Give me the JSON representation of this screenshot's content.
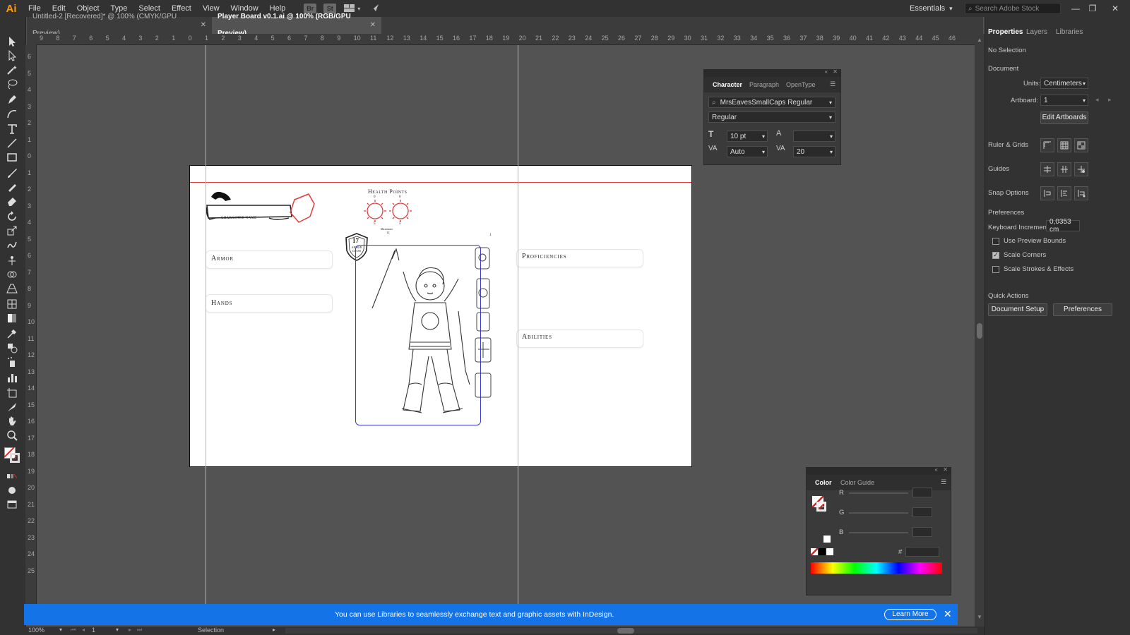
{
  "app": {
    "logo": "Ai",
    "menu": [
      "File",
      "Edit",
      "Object",
      "Type",
      "Select",
      "Effect",
      "View",
      "Window",
      "Help"
    ],
    "menubar_icons": [
      "Br",
      "St"
    ],
    "workspace": "Essentials",
    "search_placeholder": "Search Adobe Stock"
  },
  "tabs": [
    {
      "label": "Untitled-2 [Recovered]* @ 100% (CMYK/GPU Preview)"
    },
    {
      "label": "Player Board v0.1.ai @ 100% (RGB/GPU Preview)"
    }
  ],
  "hruler": [
    "9",
    "8",
    "7",
    "6",
    "5",
    "4",
    "3",
    "2",
    "1",
    "0",
    "1",
    "2",
    "3",
    "4",
    "5",
    "6",
    "7",
    "8",
    "9",
    "10",
    "11",
    "12",
    "13",
    "14",
    "15",
    "16",
    "17",
    "18",
    "19",
    "20",
    "21",
    "22",
    "23",
    "24",
    "25",
    "26",
    "27",
    "28",
    "29",
    "30",
    "31",
    "32",
    "33",
    "34",
    "35",
    "36",
    "37",
    "38",
    "39",
    "40",
    "41",
    "42",
    "43",
    "44",
    "45",
    "46"
  ],
  "vruler": [
    "6",
    "5",
    "4",
    "3",
    "2",
    "1",
    "0",
    "1",
    "2",
    "3",
    "4",
    "5",
    "6",
    "7",
    "8",
    "9",
    "10",
    "11",
    "12",
    "13",
    "14",
    "15",
    "16",
    "17",
    "18",
    "19",
    "20",
    "21",
    "22",
    "23",
    "24",
    "25"
  ],
  "artboard": {
    "character_name": "CHARACTER NAME",
    "health_points_title": "Health Points",
    "hp_values": [
      "0",
      "0"
    ],
    "hp_subvalues": [
      "5",
      "5"
    ],
    "hp_maximum_label": "Maximum",
    "hp_maximum_value": "12",
    "armor_class_value": "17",
    "armor_class_label": "ARMOR CLASS",
    "slot_number": "1",
    "armor_label": "Armor",
    "hands_label": "Hands",
    "proficiencies_label": "Proficiencies",
    "abilities_label": "Abilities"
  },
  "character_panel": {
    "tabs": [
      "Character",
      "Paragraph",
      "OpenType"
    ],
    "font_family": "MrsEavesSmallCaps Regular",
    "font_style": "Regular",
    "font_size": "10 pt",
    "leading": "",
    "kerning": "Auto",
    "tracking": "20"
  },
  "properties": {
    "tabs": [
      "Properties",
      "Layers",
      "Libraries"
    ],
    "selection": "No Selection",
    "document_heading": "Document",
    "units_label": "Units:",
    "units_value": "Centimeters",
    "artboard_label": "Artboard:",
    "artboard_value": "1",
    "edit_artboards": "Edit Artboards",
    "ruler_grids": "Ruler & Grids",
    "guides": "Guides",
    "snap_options": "Snap Options",
    "preferences_heading": "Preferences",
    "keyboard_increment_label": "Keyboard Increment:",
    "keyboard_increment_value": "0,0353 cm",
    "use_preview_bounds": "Use Preview Bounds",
    "scale_corners": "Scale Corners",
    "scale_strokes": "Scale Strokes & Effects",
    "quick_actions": "Quick Actions",
    "document_setup": "Document Setup",
    "preferences_btn": "Preferences"
  },
  "color_panel": {
    "tabs": [
      "Color",
      "Color Guide"
    ],
    "labels": [
      "R",
      "G",
      "B"
    ],
    "hash": "#"
  },
  "notification": {
    "message": "You can use Libraries to seamlessly exchange text and graphic assets with InDesign.",
    "button": "Learn More"
  },
  "status": {
    "zoom": "100%",
    "artboard_num": "1",
    "tool": "Selection"
  },
  "colors": {
    "accent": "#1473e6",
    "guide": "#5ad8f0",
    "red_line": "#e43b3b",
    "frame_blue": "#3b3bd6",
    "logo": "#ff9a00"
  }
}
